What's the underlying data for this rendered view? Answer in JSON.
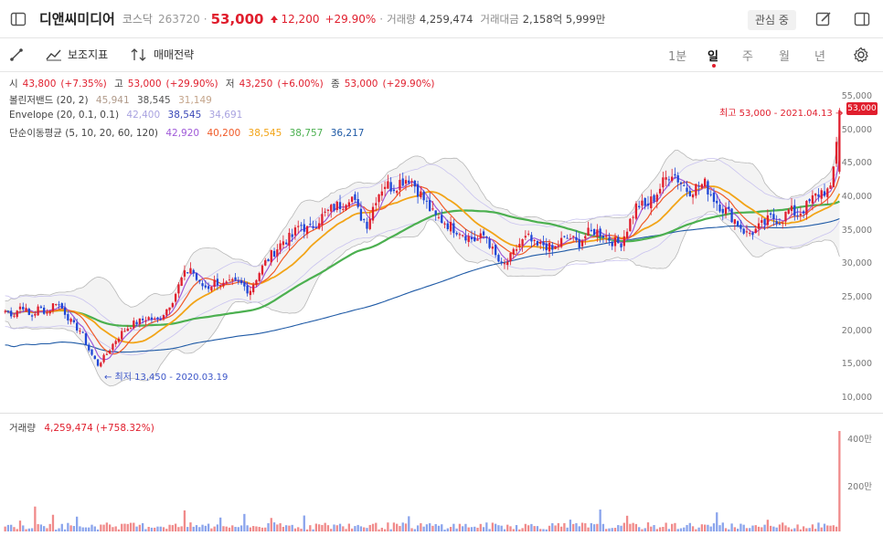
{
  "header": {
    "company": "디앤씨미디어",
    "market": "코스닥",
    "code": "263720",
    "price": "53,000",
    "change": "12,200",
    "change_pct": "+29.90%",
    "volume_label": "거래량",
    "volume": "4,259,474",
    "amount_label": "거래대금",
    "amount": "2,158억 5,999만",
    "favorite_label": "관심 중"
  },
  "toolbar": {
    "aux_indicator": "보조지표",
    "trade_strategy": "매매전략",
    "periods": [
      "1분",
      "일",
      "주",
      "월",
      "년"
    ],
    "active_period": "일"
  },
  "ohlc": {
    "open_label": "시",
    "open": "43,800",
    "open_pct": "(+7.35%)",
    "high_label": "고",
    "high": "53,000",
    "high_pct": "(+29.90%)",
    "low_label": "저",
    "low": "43,250",
    "low_pct": "(+6.00%)",
    "close_label": "종",
    "close": "53,000",
    "close_pct": "(+29.90%)"
  },
  "bollinger": {
    "label": "볼린저밴드 (20, 2)",
    "upper": "45,941",
    "mid": "38,545",
    "lower": "31,149"
  },
  "envelope": {
    "label": "Envelope (20, 0.1, 0.1)",
    "upper": "42,400",
    "mid": "38,545",
    "lower": "34,691"
  },
  "ma": {
    "label": "단순이동평균 (5, 10, 20, 60, 120)",
    "ma5": "42,920",
    "ma10": "40,200",
    "ma20": "38,545",
    "ma60": "38,757",
    "ma120": "36,217"
  },
  "annotations": {
    "high": "최고 53,000 - 2021.04.13 →",
    "low": "← 최저 13,450 - 2020.03.19",
    "price_tag": "53,000"
  },
  "volume_panel": {
    "label": "거래량",
    "value": "4,259,474 (+758.32%)"
  },
  "colors": {
    "up": "#e01e2d",
    "down": "#1f47d6",
    "ma5": "#a05ad8",
    "ma10": "#f05a28",
    "ma20": "#f2a417",
    "ma60": "#4cb050",
    "ma120": "#1f5aa6",
    "bb": "#a0a0a0"
  },
  "chart_data": {
    "type": "candlestick",
    "y_axis_ticks": [
      "55,000",
      "50,000",
      "45,000",
      "40,000",
      "35,000",
      "30,000",
      "25,000",
      "20,000",
      "15,000",
      "10,000"
    ],
    "ylim": [
      10000,
      55000
    ],
    "volume_axis_ticks": [
      "400만",
      "200만"
    ],
    "close_path": [
      23000,
      22500,
      24000,
      22000,
      23500,
      22800,
      24500,
      23000,
      21000,
      20000,
      17000,
      15000,
      16500,
      18500,
      20000,
      21000,
      21500,
      22000,
      21500,
      23000,
      25000,
      28000,
      29500,
      27000,
      26500,
      27500,
      26800,
      27200,
      27000,
      26000,
      28500,
      30500,
      32000,
      33500,
      34000,
      36000,
      35000,
      36500,
      37500,
      38500,
      39000,
      40500,
      37500,
      36000,
      40000,
      42000,
      41500,
      42500,
      43000,
      41000,
      39000,
      37000,
      36500,
      35500,
      35000,
      34000,
      33500,
      34500,
      31500,
      29500,
      31000,
      33000,
      34000,
      32500,
      33000,
      32000,
      33500,
      34000,
      33000,
      34500,
      35000,
      34500,
      33500,
      33000,
      36000,
      39000,
      38500,
      40000,
      42000,
      44000,
      42500,
      41000,
      41500,
      42000,
      40000,
      38500,
      37500,
      36000,
      34500,
      35000,
      36000,
      37000,
      36500,
      38000,
      37500,
      38500,
      40000,
      41000,
      40800,
      53000
    ],
    "high": {
      "value": 53000,
      "date": "2021.04.13"
    },
    "low": {
      "value": 13450,
      "date": "2020.03.19"
    }
  }
}
